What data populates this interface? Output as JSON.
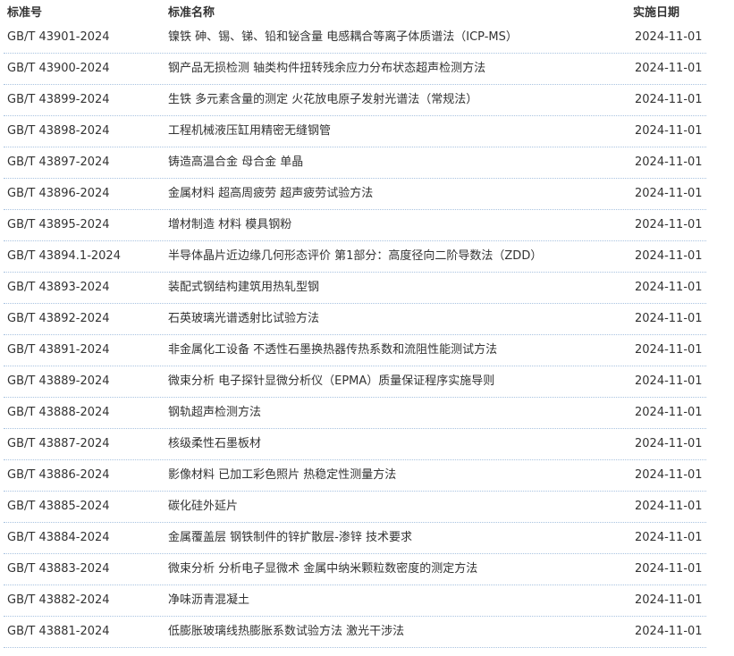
{
  "header": {
    "code_label": "标准号",
    "name_label": "标准名称",
    "date_label": "实施日期"
  },
  "rows": [
    {
      "code": "GB/T 43901-2024",
      "name": "镍铁 砷、锡、锑、铅和铋含量 电感耦合等离子体质谱法（ICP-MS）",
      "date": "2024-11-01"
    },
    {
      "code": "GB/T 43900-2024",
      "name": "钢产品无损检测 轴类构件扭转残余应力分布状态超声检测方法",
      "date": "2024-11-01"
    },
    {
      "code": "GB/T 43899-2024",
      "name": "生铁 多元素含量的测定 火花放电原子发射光谱法（常规法）",
      "date": "2024-11-01"
    },
    {
      "code": "GB/T 43898-2024",
      "name": "工程机械液压缸用精密无缝钢管",
      "date": "2024-11-01"
    },
    {
      "code": "GB/T 43897-2024",
      "name": "铸造高温合金 母合金 单晶",
      "date": "2024-11-01"
    },
    {
      "code": "GB/T 43896-2024",
      "name": "金属材料 超高周疲劳 超声疲劳试验方法",
      "date": "2024-11-01"
    },
    {
      "code": "GB/T 43895-2024",
      "name": "增材制造 材料 模具钢粉",
      "date": "2024-11-01"
    },
    {
      "code": "GB/T 43894.1-2024",
      "name": "半导体晶片近边缘几何形态评价 第1部分：高度径向二阶导数法（ZDD）",
      "date": "2024-11-01"
    },
    {
      "code": "GB/T 43893-2024",
      "name": "装配式钢结构建筑用热轧型钢",
      "date": "2024-11-01"
    },
    {
      "code": "GB/T 43892-2024",
      "name": "石英玻璃光谱透射比试验方法",
      "date": "2024-11-01"
    },
    {
      "code": "GB/T 43891-2024",
      "name": "非金属化工设备 不透性石墨换热器传热系数和流阻性能测试方法",
      "date": "2024-11-01"
    },
    {
      "code": "GB/T 43889-2024",
      "name": "微束分析 电子探针显微分析仪（EPMA）质量保证程序实施导则",
      "date": "2024-11-01"
    },
    {
      "code": "GB/T 43888-2024",
      "name": "钢轨超声检测方法",
      "date": "2024-11-01"
    },
    {
      "code": "GB/T 43887-2024",
      "name": "核级柔性石墨板材",
      "date": "2024-11-01"
    },
    {
      "code": "GB/T 43886-2024",
      "name": "影像材料 已加工彩色照片 热稳定性测量方法",
      "date": "2024-11-01"
    },
    {
      "code": "GB/T 43885-2024",
      "name": "碳化硅外延片",
      "date": "2024-11-01"
    },
    {
      "code": "GB/T 43884-2024",
      "name": "金属覆盖层 钢铁制件的锌扩散层-渗锌 技术要求",
      "date": "2024-11-01"
    },
    {
      "code": "GB/T 43883-2024",
      "name": "微束分析 分析电子显微术 金属中纳米颗粒数密度的测定方法",
      "date": "2024-11-01"
    },
    {
      "code": "GB/T 43882-2024",
      "name": "净味沥青混凝土",
      "date": "2024-11-01"
    },
    {
      "code": "GB/T 43881-2024",
      "name": "低膨胀玻璃线热膨胀系数试验方法 激光干涉法",
      "date": "2024-11-01"
    }
  ]
}
